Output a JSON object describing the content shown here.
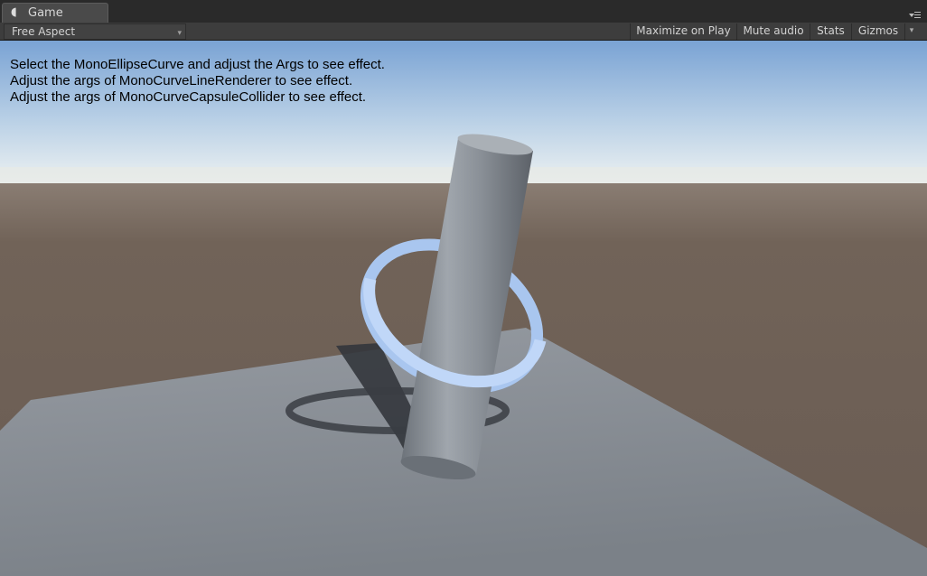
{
  "window": {
    "tab_label": "Game",
    "tab_icon": "unity-game-icon"
  },
  "toolbar": {
    "aspect_label": "Free Aspect",
    "maximize_label": "Maximize on Play",
    "mute_label": "Mute audio",
    "stats_label": "Stats",
    "gizmos_label": "Gizmos"
  },
  "viewport": {
    "info_lines": [
      "Select the MonoEllipseCurve and adjust the Args to see effect.",
      "Adjust the args of MonoCurveLineRenderer to see effect.",
      "Adjust the args of MonoCurveCapsuleCollider to see effect."
    ]
  },
  "colors": {
    "sky_top": "#7ea6d6",
    "horizon": "#e6eef2",
    "ground": "#6e6159",
    "plane": "#8b9199",
    "cylinder": "#8d939a",
    "ring": "#b7d2f7",
    "shadow": "#2f3238"
  }
}
